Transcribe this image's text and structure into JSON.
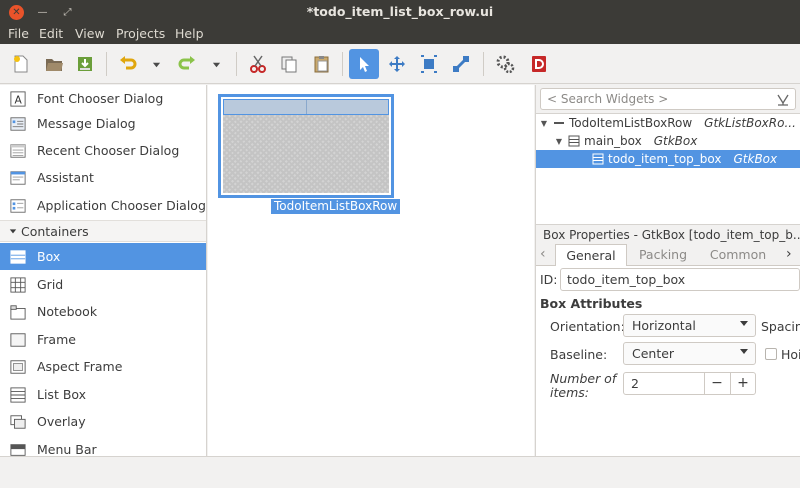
{
  "window": {
    "title": "*todo_item_list_box_row.ui",
    "close_glyph": "✕",
    "min_glyph": "—",
    "max_glyph": "⤢"
  },
  "menu": [
    "File",
    "Edit",
    "View",
    "Projects",
    "Help"
  ],
  "toolbar_icons": [
    "new-file-icon",
    "open-folder-icon",
    "save-icon",
    "undo-icon",
    "redo-icon",
    "cut-icon",
    "copy-icon",
    "paste-icon",
    "pointer-icon",
    "drag-resize-icon",
    "margin-edit-icon",
    "align-edit-icon",
    "preferences-icon",
    "devhelp-icon"
  ],
  "palette": {
    "items_top": [
      {
        "label": "Font Chooser Dialog",
        "icon": "font-chooser-icon"
      },
      {
        "label": "Message Dialog",
        "icon": "message-dialog-icon"
      },
      {
        "label": "Recent Chooser Dialog",
        "icon": "recent-chooser-icon"
      },
      {
        "label": "Assistant",
        "icon": "assistant-icon"
      },
      {
        "label": "Application Chooser Dialog",
        "icon": "app-chooser-icon"
      }
    ],
    "group_label": "Containers",
    "items": [
      {
        "label": "Box",
        "icon": "box-icon",
        "selected": true
      },
      {
        "label": "Grid",
        "icon": "grid-icon"
      },
      {
        "label": "Notebook",
        "icon": "notebook-icon"
      },
      {
        "label": "Frame",
        "icon": "frame-icon"
      },
      {
        "label": "Aspect Frame",
        "icon": "aspect-frame-icon"
      },
      {
        "label": "List Box",
        "icon": "list-box-icon"
      },
      {
        "label": "Overlay",
        "icon": "overlay-icon"
      },
      {
        "label": "Menu Bar",
        "icon": "menu-bar-icon"
      }
    ]
  },
  "canvas": {
    "widget_label": "TodoItemListBoxRow"
  },
  "inspector": {
    "search_placeholder": "< Search Widgets >",
    "tree": [
      {
        "name": "TodoItemListBoxRow",
        "cls": "GtkListBoxRo...",
        "depth": 0
      },
      {
        "name": "main_box",
        "cls": "GtkBox",
        "depth": 1
      },
      {
        "name": "todo_item_top_box",
        "cls": "GtkBox",
        "depth": 2,
        "selected": true
      }
    ]
  },
  "properties": {
    "header": "Box Properties - GtkBox [todo_item_top_b...",
    "tabs": [
      "General",
      "Packing",
      "Common"
    ],
    "id_label": "ID:",
    "id_value": "todo_item_top_box",
    "section": "Box Attributes",
    "orientation_label": "Orientation:",
    "orientation_value": "Horizontal",
    "spacing_label": "Spacin",
    "baseline_label": "Baseline:",
    "baseline_value": "Center",
    "homogeneous_label": "Hoi",
    "items_label": "Number of items:",
    "items_value": "2",
    "minus": "−",
    "plus": "+"
  },
  "colors": {
    "accent": "#5294e2",
    "titlebar": "#3c3b37"
  }
}
